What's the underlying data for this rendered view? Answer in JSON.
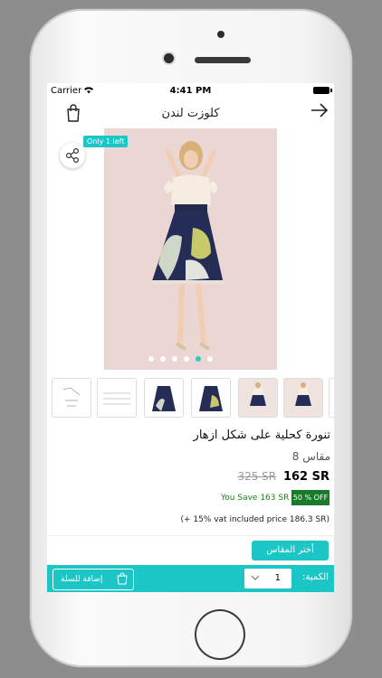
{
  "status_bar": {
    "carrier": "Carrier",
    "time": "4:41 PM"
  },
  "header": {
    "title": "كلوزت لندن"
  },
  "product": {
    "stock_badge": "Only 1 left",
    "name": "تنورة كحلية على شكل ازهار",
    "size": "مقاس 8",
    "price_now": "162 SR",
    "price_old": "325 SR",
    "you_save": "You Save 163 SR",
    "discount": "50 % OFF",
    "vat_note": "(+ 15% vat included price 186.3 SR)",
    "carousel_dots": 6,
    "carousel_active_index": 4
  },
  "actions": {
    "choose_size": "أختر المقاس",
    "quantity_label": "الكمية:",
    "quantity_value": "1",
    "add_to_cart": "إضافة للسلة"
  },
  "colors": {
    "accent": "#1cc6c6",
    "discount_bg": "#187a2a",
    "save_text": "#1b7f1b"
  },
  "icons": [
    "shopping-bag-icon",
    "arrow-right-icon",
    "share-icon",
    "chevron-down-icon",
    "wifi-icon",
    "battery-icon"
  ]
}
